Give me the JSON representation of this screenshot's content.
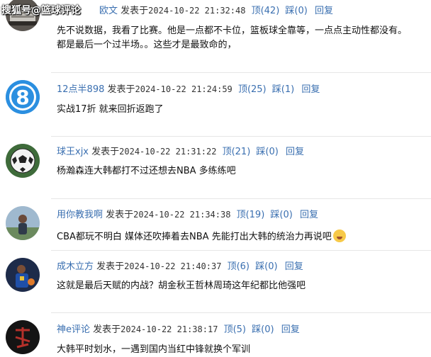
{
  "watermark": "搜狐号@篮球评论",
  "labels": {
    "posted_prefix": "发表于",
    "reply": "回复"
  },
  "comments": [
    {
      "user": "欧文",
      "time": "2024-10-22 21:32:48",
      "up": "顶(42)",
      "down": "踩(0)",
      "lines": [
        "先不说数据，我看了比赛。他是一点都不卡位，篮板球全靠等，一点点主动性都没有。",
        "都是最后一个过半场。。这些才是最致命的，"
      ],
      "avatar_icon": "laptop-avatar-icon"
    },
    {
      "user": "12点半898",
      "time": "2024-10-22 21:24:59",
      "up": "顶(25)",
      "down": "踩(1)",
      "lines": [
        "实战17折 就来回折返跑了"
      ],
      "avatar_icon": "number-eight-avatar-icon"
    },
    {
      "user": "球王xjx",
      "time": "2024-10-22 21:31:22",
      "up": "顶(21)",
      "down": "踩(0)",
      "lines": [
        "杨瀚森连大韩都打不过还想去NBA 多练练吧"
      ],
      "avatar_icon": "soccer-ball-avatar-icon"
    },
    {
      "user": "用你教我啊",
      "time": "2024-10-22 21:34:38",
      "up": "顶(19)",
      "down": "踩(0)",
      "lines": [
        "CBA都玩不明白 媒体还吹捧着去NBA 先能打出大韩的统治力再说吧"
      ],
      "avatar_icon": "person-photo-avatar-icon"
    },
    {
      "user": "成木立方",
      "time": "2024-10-22 21:40:37",
      "up": "顶(6)",
      "down": "踩(0)",
      "lines": [
        "这就是最后天赋的内战？胡金秋王哲林周琦这年纪都比他强吧"
      ],
      "avatar_icon": "basketball-player-avatar-icon"
    },
    {
      "user": "神e评论",
      "time": "2024-10-22 21:38:17",
      "up": "顶(5)",
      "down": "踩(0)",
      "lines": [
        "大韩平时划水，一遇到国内当红中锋就换个军训"
      ],
      "avatar_icon": "calligraphy-avatar-icon"
    }
  ]
}
